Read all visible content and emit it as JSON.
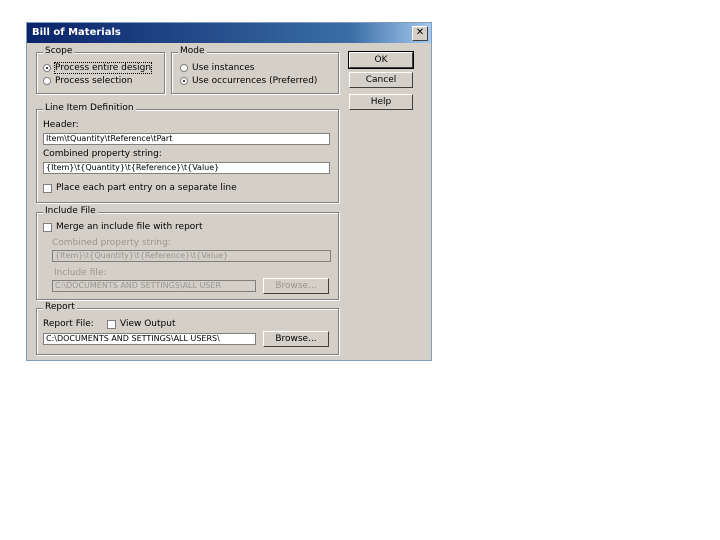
{
  "window": {
    "title": "Bill of Materials",
    "close_glyph": "✕"
  },
  "scope": {
    "title": "Scope",
    "options": [
      "Process entire design",
      "Process selection"
    ],
    "selected": 0
  },
  "mode": {
    "title": "Mode",
    "options": [
      "Use instances",
      "Use occurrences (Preferred)"
    ],
    "selected": 1
  },
  "buttons": {
    "ok": "OK",
    "cancel": "Cancel",
    "help": "Help"
  },
  "line_item": {
    "title": "Line Item Definition",
    "header_label": "Header:",
    "header_value": "Item\\tQuantity\\tReference\\tPart",
    "combined_label": "Combined property string:",
    "combined_value": "{Item}\\t{Quantity}\\t{Reference}\\t{Value}",
    "separate_label": "Place each part entry on a separate line"
  },
  "include_file": {
    "title": "Include File",
    "merge_label": "Merge an include file with report",
    "combined_label": "Combined property string:",
    "combined_value": "{Item}\\t{Quantity}\\t{Reference}\\t{Value}",
    "file_label": "Include file:",
    "file_value": "C:\\DOCUMENTS AND SETTINGS\\ALL USER",
    "browse": "Browse..."
  },
  "report": {
    "title": "Report",
    "file_label": "Report File:",
    "view_output_label": "View Output",
    "file_value": "C:\\DOCUMENTS AND SETTINGS\\ALL USERS\\",
    "browse": "Browse..."
  }
}
